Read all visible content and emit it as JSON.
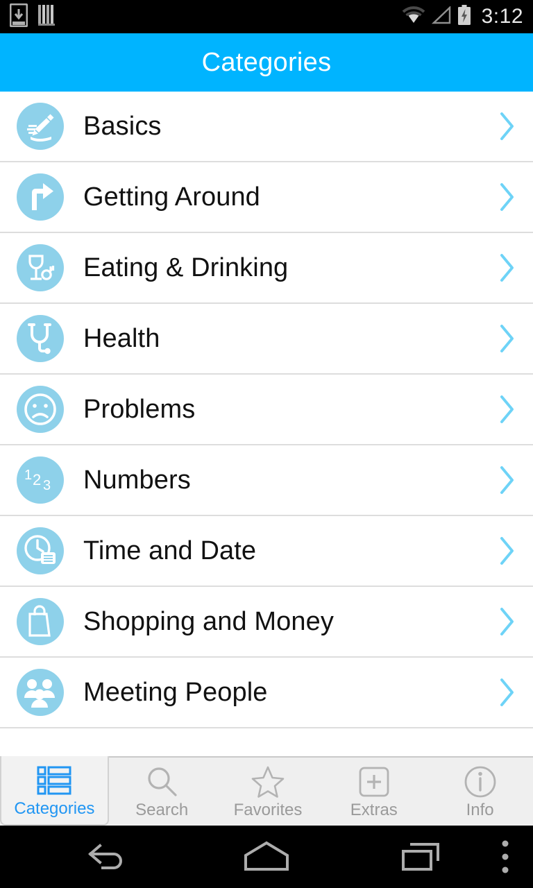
{
  "status_bar": {
    "time": "3:12",
    "left_icons": [
      {
        "name": "download-to-device-icon"
      },
      {
        "name": "vertical-bars-icon"
      }
    ],
    "right_icons": [
      {
        "name": "wifi-icon"
      },
      {
        "name": "cellular-signal-icon"
      },
      {
        "name": "battery-charging-icon"
      }
    ]
  },
  "header": {
    "title": "Categories",
    "background_color": "#00b4ff",
    "text_color": "#ffffff"
  },
  "theme": {
    "accent": "#00b4ff",
    "icon_circle": "#8ed1ea",
    "chevron": "#6ed3f7",
    "tab_active": "#2196f3",
    "tab_inactive": "#9a9a9a",
    "divider": "#dddddd"
  },
  "list": {
    "items": [
      {
        "label": "Basics",
        "icon": "pencil-writing-icon"
      },
      {
        "label": "Getting Around",
        "icon": "turn-right-arrow-icon"
      },
      {
        "label": "Eating & Drinking",
        "icon": "wine-glass-fork-icon"
      },
      {
        "label": "Health",
        "icon": "stethoscope-icon"
      },
      {
        "label": "Problems",
        "icon": "sad-face-icon"
      },
      {
        "label": "Numbers",
        "icon": "numbers-123-icon"
      },
      {
        "label": "Time and Date",
        "icon": "clock-calendar-icon"
      },
      {
        "label": "Shopping and Money",
        "icon": "shopping-bag-icon"
      },
      {
        "label": "Meeting People",
        "icon": "group-people-icon"
      }
    ],
    "chevron_glyph": "›"
  },
  "tabs": [
    {
      "label": "Categories",
      "icon": "list-view-icon",
      "active": true
    },
    {
      "label": "Search",
      "icon": "magnifier-icon",
      "active": false
    },
    {
      "label": "Favorites",
      "icon": "star-outline-icon",
      "active": false
    },
    {
      "label": "Extras",
      "icon": "plus-square-icon",
      "active": false
    },
    {
      "label": "Info",
      "icon": "info-circle-icon",
      "active": false
    }
  ],
  "nav_bar": {
    "buttons": [
      {
        "name": "back-button"
      },
      {
        "name": "home-button"
      },
      {
        "name": "recents-button"
      },
      {
        "name": "overflow-menu-button"
      }
    ]
  }
}
